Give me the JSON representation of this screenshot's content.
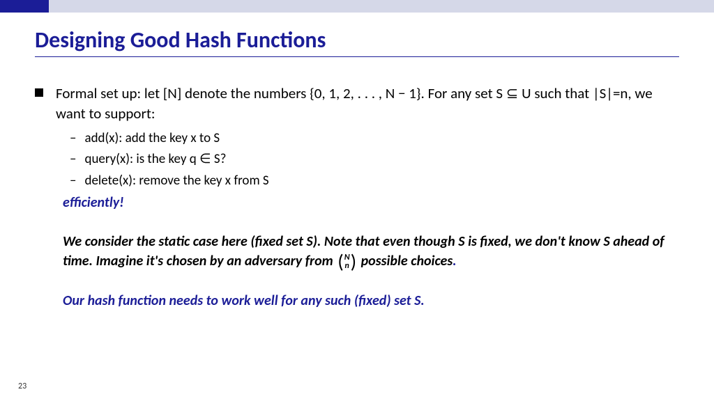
{
  "title": "Designing Good Hash Functions",
  "main_bullet": "Formal set up: let [N] denote the numbers {0, 1, 2, . . . , N − 1}.  For any set S ⊆ U such that |S|=n, we want to support:",
  "sub_items": {
    "item0": "add(x): add the key x to S",
    "item1": "query(x):  is the key q ∈ S?",
    "item2": "delete(x): remove the key x from S"
  },
  "efficiently": "efficiently!",
  "para1_part1": "We consider the static case here (fixed set S). Note that even though S is fixed, we don't know S ahead of time. Imagine it's chosen by an adversary from ",
  "binom_top": "N",
  "binom_bottom": "n",
  "para1_part2": " possible choices",
  "para1_dot": ".",
  "para2": "Our hash function needs to work well for any such (fixed) set S.",
  "page_number": "23"
}
